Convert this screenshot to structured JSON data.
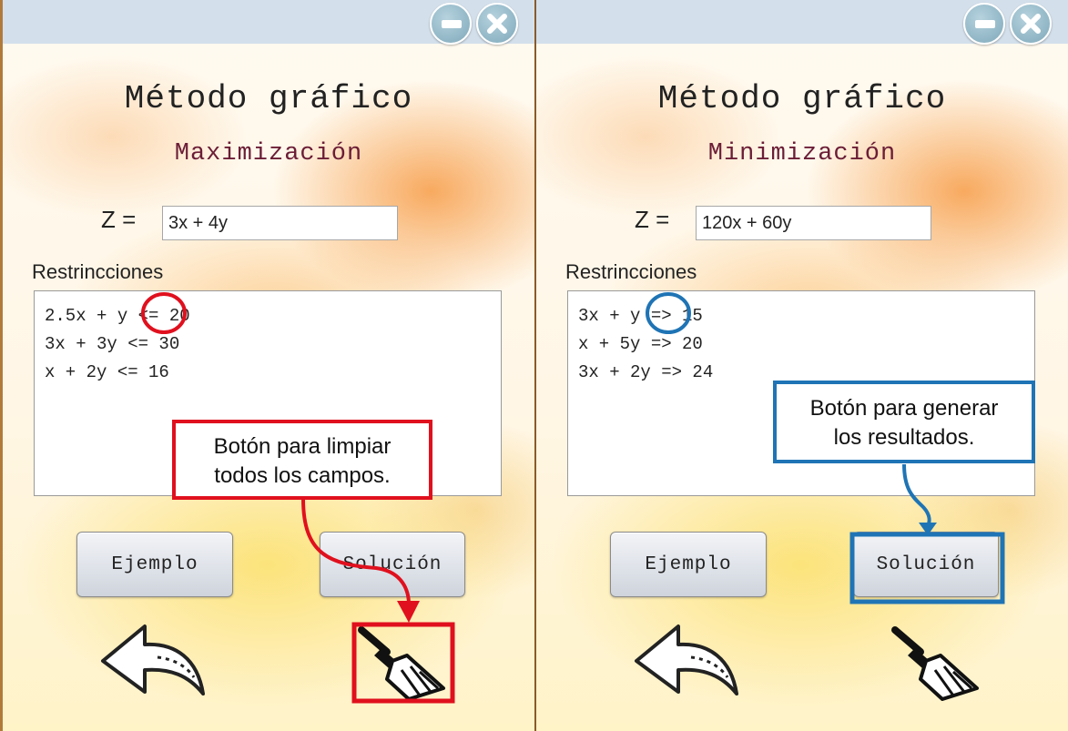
{
  "panels": [
    {
      "app_title": "Método gráfico",
      "mode_title": "Maximización",
      "objective": {
        "label": "Z =",
        "value": "3x + 4y"
      },
      "restrictions": {
        "label": "Restrincciones",
        "lines": [
          "2.5x + y <= 20",
          "3x + 3y <= 30",
          "x + 2y <= 16"
        ]
      },
      "buttons": {
        "example": "Ejemplo",
        "solution": "Solución"
      },
      "icons": {
        "back": "back-arrow-icon",
        "clear": "broom-icon"
      },
      "callout": {
        "text_line1": "Botón para limpiar",
        "text_line2": "todos los campos.",
        "color": "#e0101e"
      }
    },
    {
      "app_title": "Método gráfico",
      "mode_title": "Minimización",
      "objective": {
        "label": "Z =",
        "value": "120x + 60y"
      },
      "restrictions": {
        "label": "Restrincciones",
        "lines": [
          "3x + y => 15",
          "x + 5y => 20",
          "3x + 2y => 24"
        ]
      },
      "buttons": {
        "example": "Ejemplo",
        "solution": "Solución"
      },
      "icons": {
        "back": "back-arrow-icon",
        "clear": "broom-icon"
      },
      "callout": {
        "text_line1": "Botón para generar",
        "text_line2": "los resultados.",
        "color": "#1f74b5"
      }
    }
  ],
  "colors": {
    "titlebar": "#d3e0ec",
    "mode_title": "#6b1d36",
    "callout_red": "#e0101e",
    "callout_blue": "#1f74b5"
  }
}
